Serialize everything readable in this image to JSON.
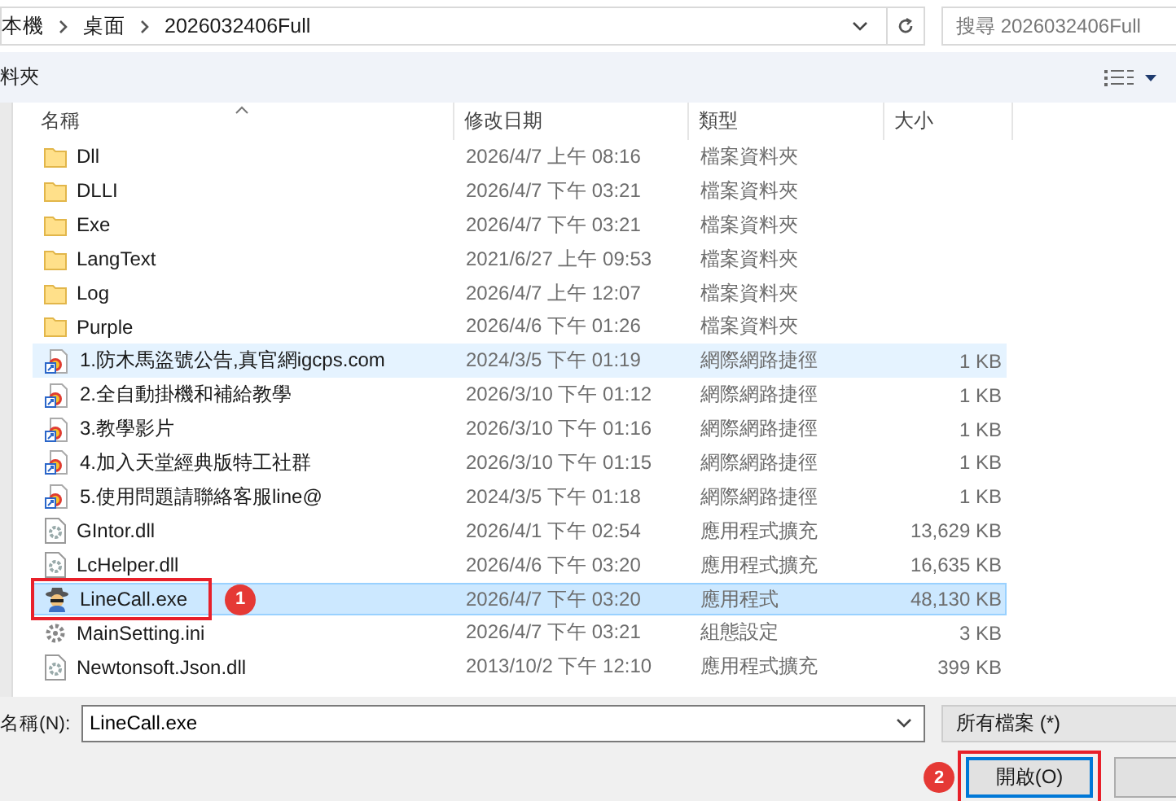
{
  "address_bar": {
    "path": [
      "本機",
      "桌面",
      "2026032406Full"
    ]
  },
  "search": {
    "placeholder": "搜尋 2026032406Full"
  },
  "toolbar": {
    "new_folder": "料夾"
  },
  "columns": [
    "名稱",
    "修改日期",
    "類型",
    "大小"
  ],
  "rows": [
    {
      "kind": "folder",
      "name": "Dll",
      "date": "2026/4/7 上午 08:16",
      "type": "檔案資料夾",
      "size": "",
      "selected": false,
      "hovered": false
    },
    {
      "kind": "folder",
      "name": "DLLI",
      "date": "2026/4/7 下午 03:21",
      "type": "檔案資料夾",
      "size": "",
      "selected": false,
      "hovered": false
    },
    {
      "kind": "folder",
      "name": "Exe",
      "date": "2026/4/7 下午 03:21",
      "type": "檔案資料夾",
      "size": "",
      "selected": false,
      "hovered": false
    },
    {
      "kind": "folder",
      "name": "LangText",
      "date": "2021/6/27 上午 09:53",
      "type": "檔案資料夾",
      "size": "",
      "selected": false,
      "hovered": false
    },
    {
      "kind": "folder",
      "name": "Log",
      "date": "2026/4/7 上午 12:07",
      "type": "檔案資料夾",
      "size": "",
      "selected": false,
      "hovered": false
    },
    {
      "kind": "folder",
      "name": "Purple",
      "date": "2026/4/6 下午 01:26",
      "type": "檔案資料夾",
      "size": "",
      "selected": false,
      "hovered": false
    },
    {
      "kind": "shortcut",
      "name": "1.防木馬盜號公告,真官網igcps.com",
      "date": "2024/3/5 下午 01:19",
      "type": "網際網路捷徑",
      "size": "1 KB",
      "selected": false,
      "hovered": true
    },
    {
      "kind": "shortcut",
      "name": "2.全自動掛機和補給教學",
      "date": "2026/3/10 下午 01:12",
      "type": "網際網路捷徑",
      "size": "1 KB",
      "selected": false,
      "hovered": false
    },
    {
      "kind": "shortcut",
      "name": "3.教學影片",
      "date": "2026/3/10 下午 01:16",
      "type": "網際網路捷徑",
      "size": "1 KB",
      "selected": false,
      "hovered": false
    },
    {
      "kind": "shortcut",
      "name": "4.加入天堂經典版特工社群",
      "date": "2026/3/10 下午 01:15",
      "type": "網際網路捷徑",
      "size": "1 KB",
      "selected": false,
      "hovered": false
    },
    {
      "kind": "shortcut",
      "name": "5.使用問題請聯絡客服line@",
      "date": "2024/3/5 下午 01:18",
      "type": "網際網路捷徑",
      "size": "1 KB",
      "selected": false,
      "hovered": false
    },
    {
      "kind": "dll",
      "name": "GIntor.dll",
      "date": "2026/4/1 下午 02:54",
      "type": "應用程式擴充",
      "size": "13,629 KB",
      "selected": false,
      "hovered": false
    },
    {
      "kind": "dll",
      "name": "LcHelper.dll",
      "date": "2026/4/6 下午 03:20",
      "type": "應用程式擴充",
      "size": "16,635 KB",
      "selected": false,
      "hovered": false
    },
    {
      "kind": "exe",
      "name": "LineCall.exe",
      "date": "2026/4/7 下午 03:20",
      "type": "應用程式",
      "size": "48,130 KB",
      "selected": true,
      "hovered": false,
      "callout": "1"
    },
    {
      "kind": "ini",
      "name": "MainSetting.ini",
      "date": "2026/4/7 下午 03:21",
      "type": "組態設定",
      "size": "3 KB",
      "selected": false,
      "hovered": false
    },
    {
      "kind": "dll",
      "name": "Newtonsoft.Json.dll",
      "date": "2013/10/2 下午 12:10",
      "type": "應用程式擴充",
      "size": "399 KB",
      "selected": false,
      "hovered": false
    }
  ],
  "file_name": {
    "label": "名稱(N):",
    "value": "LineCall.exe"
  },
  "file_type": {
    "value": "所有檔案 (*)"
  },
  "open_button": {
    "label": "開啟(O)",
    "callout": "2"
  }
}
